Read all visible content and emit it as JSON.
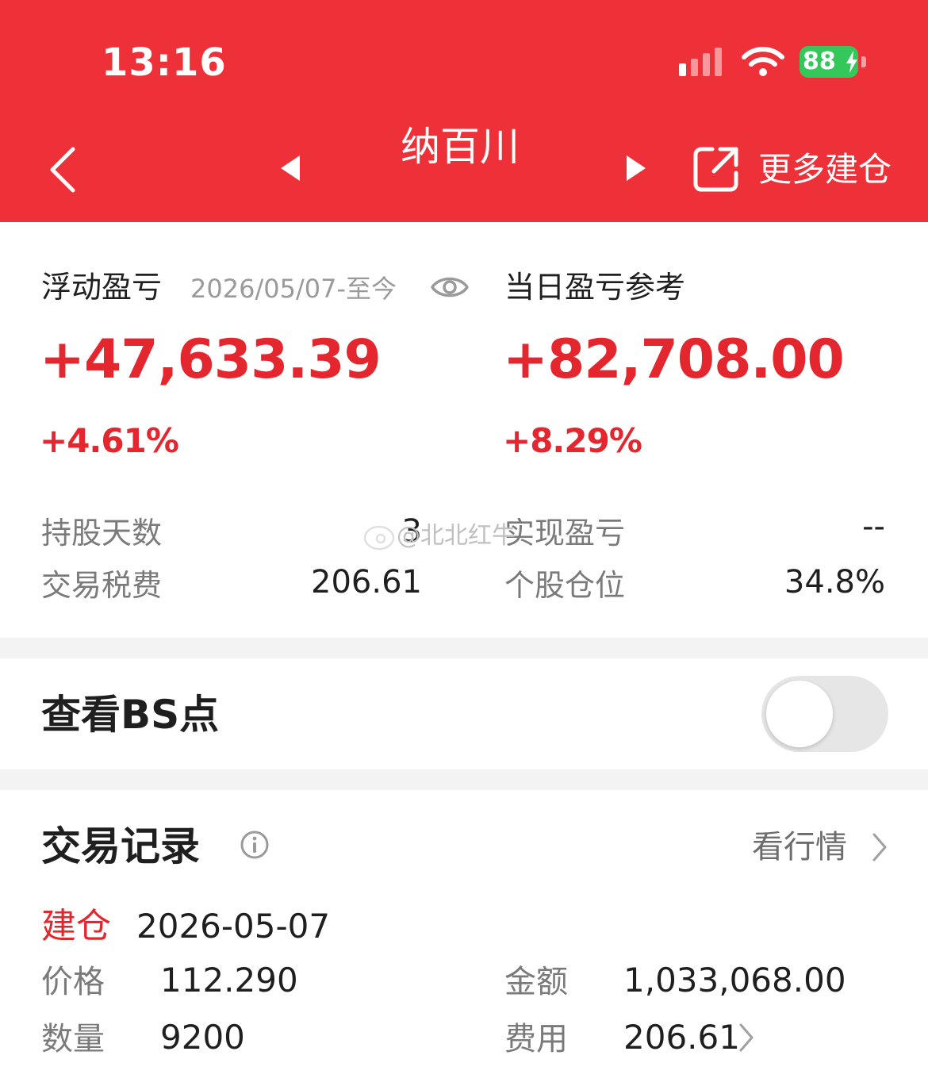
{
  "status_bar": {
    "time": "13:16",
    "battery": "88"
  },
  "nav": {
    "title": "纳百川",
    "more_label": "更多建仓"
  },
  "summary": {
    "floating_pl": {
      "label": "浮动盈亏",
      "date_range": "2026/05/07-至今",
      "value": "+47,633.39",
      "pct": "+4.61%"
    },
    "daily_pl": {
      "label": "当日盈亏参考",
      "value": "+82,708.00",
      "pct": "+8.29%"
    },
    "stats": {
      "hold_days_label": "持股天数",
      "hold_days_value": "3",
      "realized_label": "实现盈亏",
      "realized_value": "--",
      "fee_label": "交易税费",
      "fee_value": "206.61",
      "position_label": "个股仓位",
      "position_value": "34.8%"
    }
  },
  "bs_points": {
    "label": "查看BS点",
    "enabled": false
  },
  "records": {
    "title": "交易记录",
    "view_market": "看行情",
    "items": [
      {
        "type": "建仓",
        "date": "2026-05-07",
        "price_label": "价格",
        "price": "112.290",
        "amount_label": "金额",
        "amount": "1,033,068.00",
        "qty_label": "数量",
        "qty": "9200",
        "fee_label": "费用",
        "fee": "206.61"
      }
    ]
  },
  "watermark": {
    "text": "@北北红牛"
  },
  "colors": {
    "header": "#ee3038",
    "profit": "#e4262f",
    "battery": "#34c759",
    "band": "#f3f3f3"
  }
}
